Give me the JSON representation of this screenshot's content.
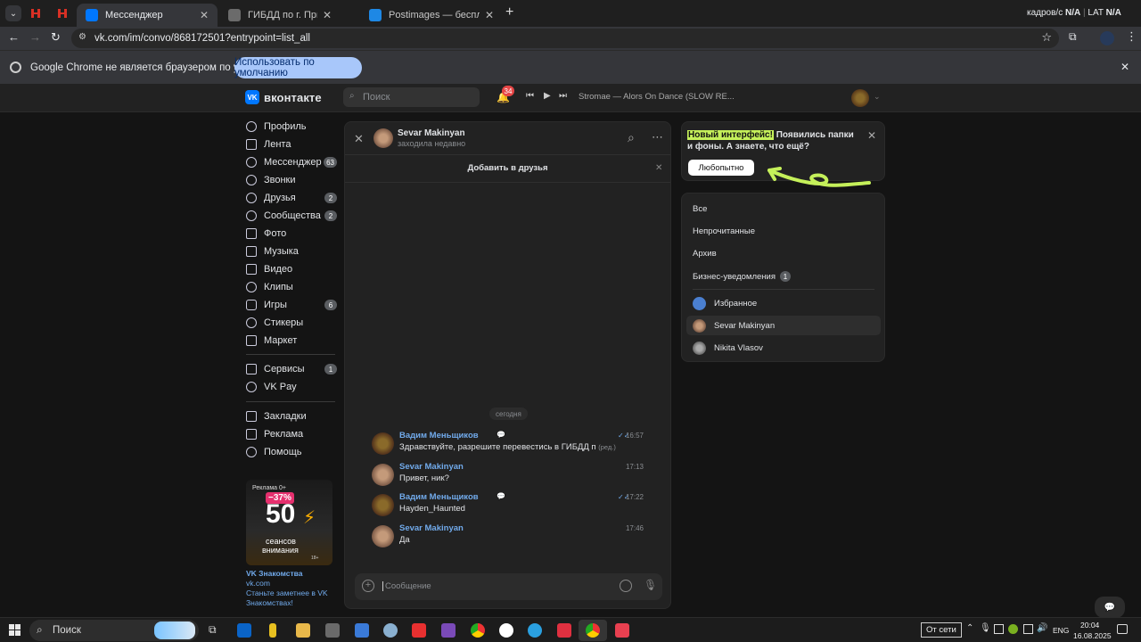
{
  "browser": {
    "tabs": [
      {
        "label": "Мессенджер"
      },
      {
        "label": "ГИБДД по г. Приволжск | Заяв"
      },
      {
        "label": "Postimages — бесплатный хос"
      }
    ],
    "profile_text": {
      "a": "кадров/с",
      "b": "N/A",
      "c": "LAT",
      "d": "N/A"
    },
    "url": "vk.com/im/convo/868172501?entrypoint=list_all",
    "infobar_text": "Google Chrome не является браузером по умолчанию.",
    "infobar_button": "Использовать по умолчанию"
  },
  "vk_header": {
    "logo": "вконтакте",
    "search_placeholder": "Поиск",
    "notifications_count": "34",
    "now_playing": "Stromae — Alors On Dance (SLOW RE..."
  },
  "sidebar": {
    "items": [
      {
        "label": "Профиль",
        "badge": ""
      },
      {
        "label": "Лента",
        "badge": ""
      },
      {
        "label": "Мессенджер",
        "badge": "63"
      },
      {
        "label": "Звонки",
        "badge": ""
      },
      {
        "label": "Друзья",
        "badge": "2"
      },
      {
        "label": "Сообщества",
        "badge": "2"
      },
      {
        "label": "Фото",
        "badge": ""
      },
      {
        "label": "Музыка",
        "badge": ""
      },
      {
        "label": "Видео",
        "badge": ""
      },
      {
        "label": "Клипы",
        "badge": ""
      },
      {
        "label": "Игры",
        "badge": "6"
      },
      {
        "label": "Стикеры",
        "badge": ""
      },
      {
        "label": "Маркет",
        "badge": ""
      }
    ],
    "items2": [
      {
        "label": "Сервисы",
        "badge": "1"
      },
      {
        "label": "VK Pay",
        "badge": ""
      }
    ],
    "items3": [
      {
        "label": "Закладки"
      },
      {
        "label": "Реклама"
      },
      {
        "label": "Помощь"
      }
    ],
    "ad": {
      "tag": "Реклама 0+",
      "discount": "−37%",
      "big_number": "50",
      "line1": "сеансов",
      "line2": "внимания",
      "age": "18+",
      "title": "VK Знакомства",
      "domain": "vk.com",
      "desc": "Станьте заметнее в VK Знакомствах!"
    }
  },
  "chat": {
    "contact_name": "Sevar Makinyan",
    "contact_status": "заходила недавно",
    "add_friend": "Добавить в друзья",
    "date_divider": "сегодня",
    "messages": [
      {
        "name": "Вадим Меньщиков",
        "text": "Здравствуйте, разрешите перевестись в ГИБДД п",
        "edited": "(ред.)",
        "time": "16:57"
      },
      {
        "name": "Sevar Makinyan",
        "text": "Привет, ник?",
        "edited": "",
        "time": "17:13"
      },
      {
        "name": "Вадим Меньщиков",
        "text": "Hayden_Haunted",
        "edited": "",
        "time": "17:22"
      },
      {
        "name": "Sevar Makinyan",
        "text": "Да",
        "edited": "",
        "time": "17:46"
      }
    ],
    "input_placeholder": "Сообщение"
  },
  "promo": {
    "highlight": "Новый интерфейс!",
    "text1": " Появились папки",
    "text2": "и фоны. А знаете, что ещё?",
    "button": "Любопытно"
  },
  "filters": {
    "items": [
      {
        "label": "Все"
      },
      {
        "label": "Непрочитанные"
      },
      {
        "label": "Архив"
      },
      {
        "label": "Бизнес-уведомления",
        "badge": "1"
      }
    ],
    "chats": [
      {
        "label": "Избранное"
      },
      {
        "label": "Sevar Makinyan"
      },
      {
        "label": "Nikita Vlasov"
      }
    ]
  },
  "taskbar": {
    "search_label": "Поиск",
    "network_status": "От сети",
    "lang": "ENG",
    "time": "20:04",
    "date": "16.08.2025"
  },
  "colors": {
    "vk_blue": "#0077ff",
    "link": "#71aaeb",
    "promo_green": "#c5f05a",
    "chrome_blue": "#a8c7fa"
  }
}
